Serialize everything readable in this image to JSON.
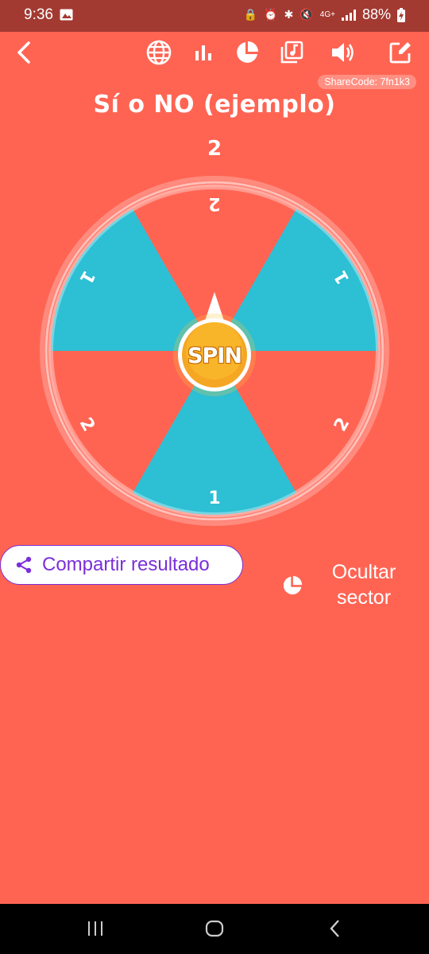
{
  "status": {
    "time": "9:36",
    "network": "4G+",
    "battery": "88%"
  },
  "toolbar": {
    "icons": [
      "back-icon",
      "globe-icon",
      "bar-chart-icon",
      "pie-chart-icon",
      "music-library-icon",
      "volume-icon",
      "edit-icon"
    ]
  },
  "share_code": "ShareCode: 7fn1k3",
  "title": "Sí o NO (ejemplo)",
  "result": "2",
  "wheel": {
    "spin_label": "SPIN",
    "sectors": [
      {
        "label": "2",
        "color": "#FF6453"
      },
      {
        "label": "1",
        "color": "#2DBFD3"
      },
      {
        "label": "2",
        "color": "#FF6453"
      },
      {
        "label": "1",
        "color": "#2DBFD3"
      },
      {
        "label": "2",
        "color": "#FF6453"
      },
      {
        "label": "1",
        "color": "#2DBFD3"
      }
    ]
  },
  "actions": {
    "share_label": "Compartir resultado",
    "hide_sector_label": "Ocultar sector"
  },
  "colors": {
    "background": "#FF6453",
    "status_bar": "#A23A32",
    "sector_blue": "#2DBFD3",
    "accent_purple": "#7B2FD8",
    "spin_orange": "#F5A623"
  }
}
